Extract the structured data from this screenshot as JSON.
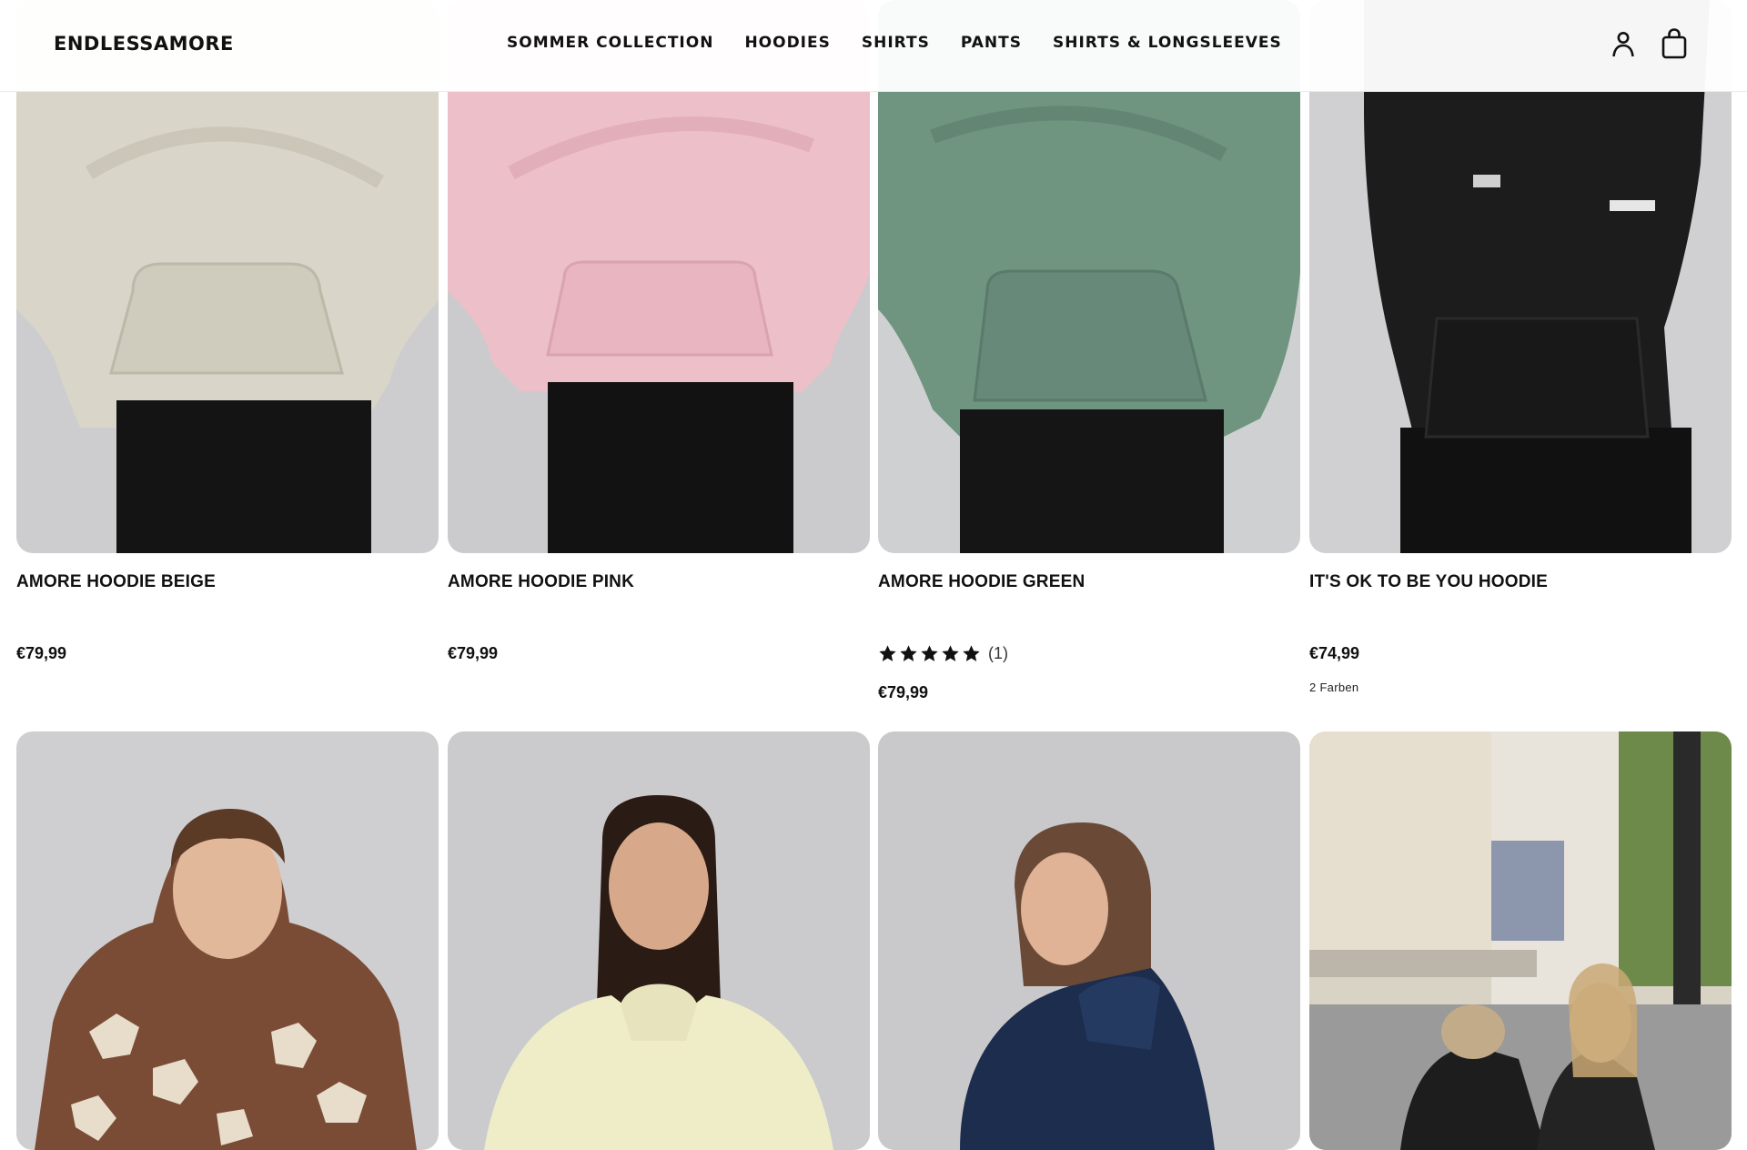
{
  "header": {
    "logo": "ENDLESSAMORE",
    "nav": [
      "SOMMER COLLECTION",
      "HOODIES",
      "SHIRTS",
      "PANTS",
      "SHIRTS & LONGSLEEVES"
    ]
  },
  "products": [
    {
      "title": "AMORE HOODIE BEIGE",
      "price": "€79,99",
      "color": "#d9d5c8"
    },
    {
      "title": "AMORE HOODIE PINK",
      "price": "€79,99",
      "color": "#edbfc9"
    },
    {
      "title": "AMORE HOODIE GREEN",
      "price": "€79,99",
      "color": "#6f9580",
      "rating_count": "(1)"
    },
    {
      "title": "IT'S OK TO BE YOU HOODIE",
      "price": "€74,99",
      "color": "#1c1c1c",
      "colors_note": "2 Farben"
    }
  ],
  "colors": {
    "accent": "#111111",
    "image_bg": "#d3d3d5"
  }
}
